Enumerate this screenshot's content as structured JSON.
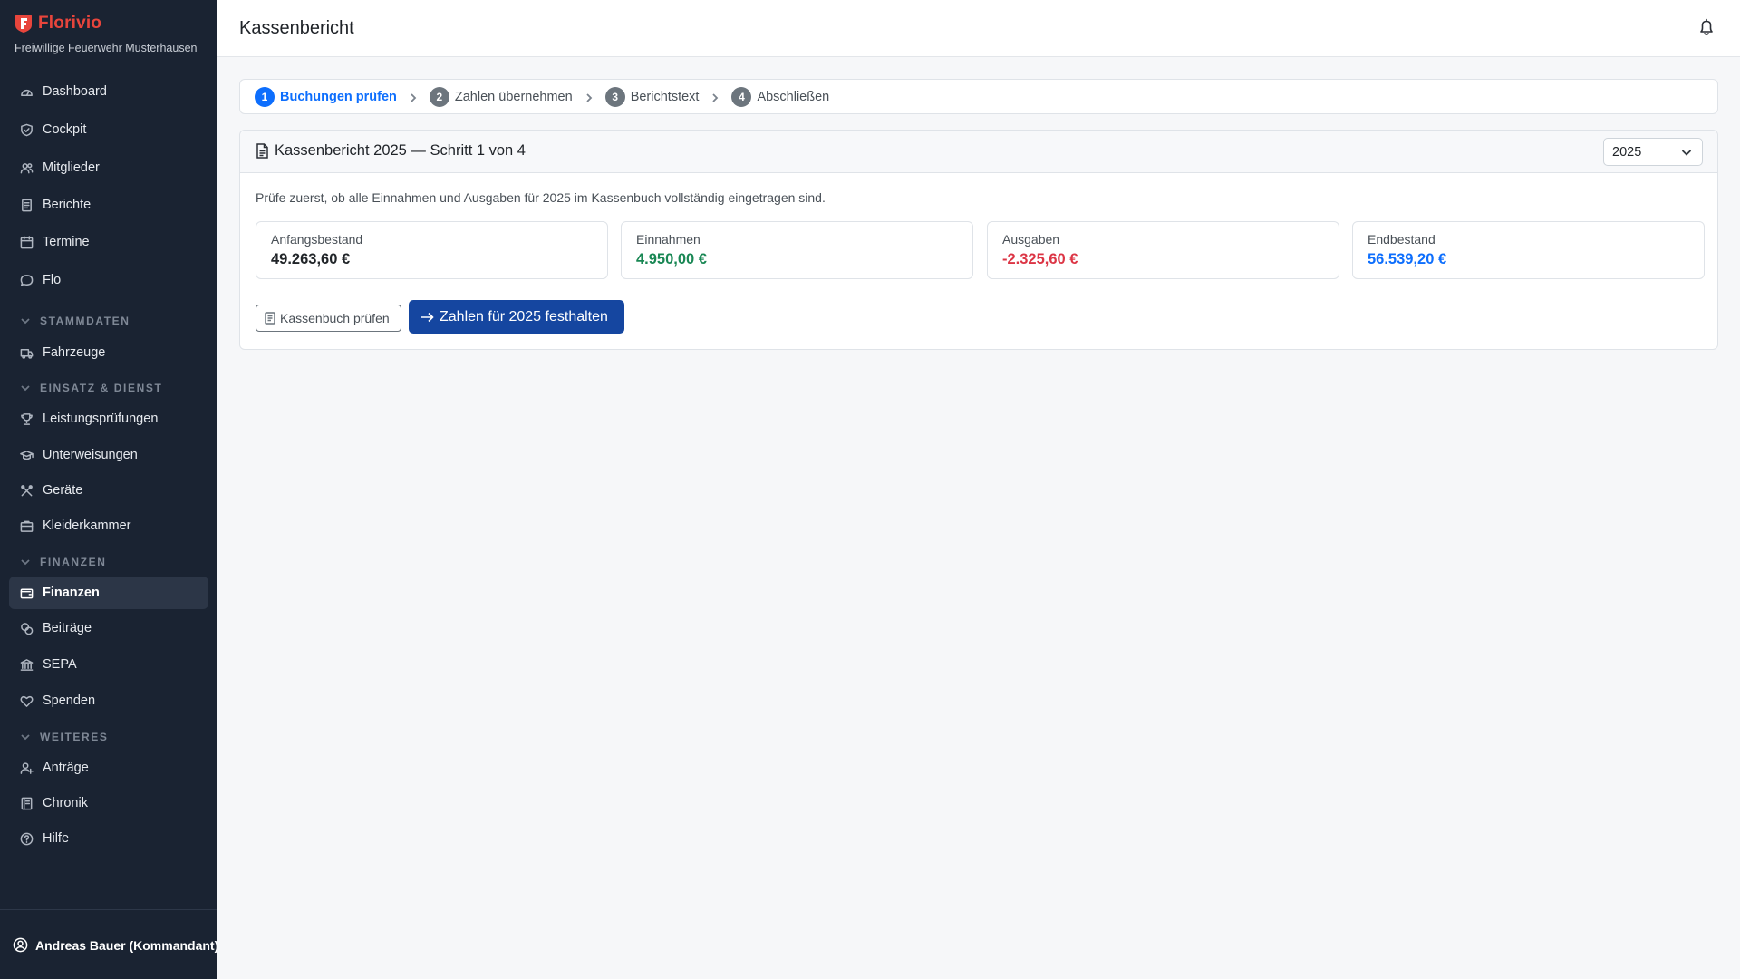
{
  "sidebar": {
    "brand_name": "Florivio",
    "brand_subtitle": "Freiwillige Feuerwehr Musterhausen",
    "items": {
      "dashboard": "Dashboard",
      "cockpit": "Cockpit",
      "mitglieder": "Mitglieder",
      "berichte": "Berichte",
      "termine": "Termine",
      "flo": "Flo",
      "fahrzeuge": "Fahrzeuge",
      "leistungspruefungen": "Leistungsprüfungen",
      "unterweisungen": "Unterweisungen",
      "geraete": "Geräte",
      "kleiderkammer": "Kleiderkammer",
      "finanzen": "Finanzen",
      "beitraege": "Beiträge",
      "sepa": "SEPA",
      "spenden": "Spenden",
      "antraege": "Anträge",
      "chronik": "Chronik",
      "hilfe": "Hilfe"
    },
    "sections": {
      "stammdaten": "STAMMDATEN",
      "einsatz": "EINSATZ & DIENST",
      "finanzen": "FINANZEN",
      "weiteres": "WEITERES"
    },
    "active_item": "Finanzen",
    "user": "Andreas Bauer (Kommandant)"
  },
  "header": {
    "title": "Kassenbericht"
  },
  "stepper": {
    "steps": [
      {
        "num": "1",
        "label": "Buchungen prüfen"
      },
      {
        "num": "2",
        "label": "Zahlen übernehmen"
      },
      {
        "num": "3",
        "label": "Berichtstext"
      },
      {
        "num": "4",
        "label": "Abschließen"
      }
    ],
    "active_step": 1
  },
  "card": {
    "title": "Kassenbericht 2025 — Schritt 1 von 4",
    "year_selected": "2025",
    "intro": "Prüfe zuerst, ob alle Einnahmen und Ausgaben für 2025 im Kassenbuch vollständig eingetragen sind.",
    "stats": [
      {
        "label": "Anfangsbestand",
        "value": "49.263,60 €",
        "color": "#212529"
      },
      {
        "label": "Einnahmen",
        "value": "4.950,00 €",
        "color": "#198754"
      },
      {
        "label": "Ausgaben",
        "value": "-2.325,60 €",
        "color": "#dc3545"
      },
      {
        "label": "Endbestand",
        "value": "56.539,20 €",
        "color": "#0d6efd"
      }
    ],
    "btn_check": "Kassenbuch prüfen",
    "btn_next": "Zahlen für 2025 festhalten"
  },
  "colors": {
    "sidebar_bg": "#1a2332",
    "brand": "#e8453c",
    "primary": "#1546a0",
    "active_step": "#0d6efd"
  }
}
